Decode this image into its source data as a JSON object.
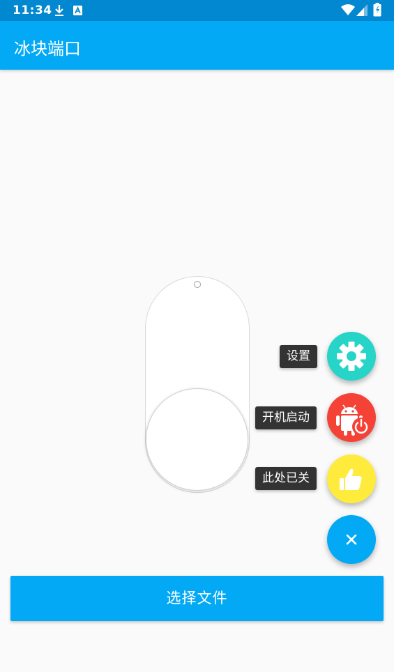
{
  "status_bar": {
    "time": "11:34",
    "icons": [
      "download-icon",
      "app-notification-icon",
      "wifi-icon",
      "signal-icon",
      "battery-icon"
    ]
  },
  "app_bar": {
    "title": "冰块端口"
  },
  "toggle": {
    "state": "off"
  },
  "fab_menu": {
    "items": [
      {
        "label": "设置",
        "icon": "gear-icon",
        "color": "#26d4c8"
      },
      {
        "label": "开机启动",
        "icon": "android-power-icon",
        "color": "#f44336"
      },
      {
        "label": "此处已关",
        "icon": "thumbs-up-icon",
        "color": "#ffeb3b"
      }
    ],
    "main": {
      "icon": "close-icon",
      "color": "#03a9f4"
    }
  },
  "select_button": {
    "label": "选择文件"
  },
  "colors": {
    "status_bar": "#0288d1",
    "primary": "#03a9f4",
    "background": "#fafafa"
  }
}
